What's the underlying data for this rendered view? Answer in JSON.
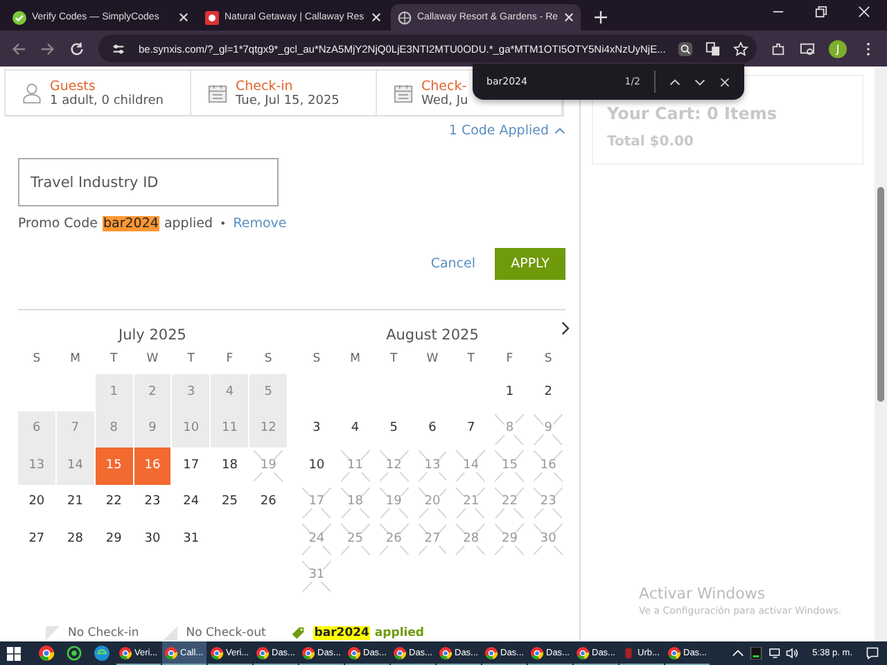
{
  "browser": {
    "tabs": [
      {
        "title": "Verify Codes — SimplyCodes",
        "kind": "check",
        "selected": false
      },
      {
        "title": "Natural Getaway | Callaway Res",
        "kind": "flower",
        "selected": false
      },
      {
        "title": "Callaway Resort & Gardens - Re",
        "kind": "globe",
        "selected": true
      }
    ],
    "url": "be.synxis.com/?_gl=1*7qtgx9*_gcl_au*NzA5MjY2NjQ0LjE3NTI2MTU0ODU.*_ga*MTM1OTI5OTY5Ni4xNzUyNjE...",
    "profile": "J",
    "find_bar": {
      "query": "bar2024",
      "count": "1/2"
    }
  },
  "summary": [
    {
      "kind": "guests",
      "label": "Guests",
      "value": "1 adult, 0 children"
    },
    {
      "kind": "date",
      "label": "Check-in",
      "value": "Tue, Jul 15, 2025"
    },
    {
      "kind": "date",
      "label": "Check-",
      "value": "Wed, Ju"
    }
  ],
  "codes_toggle": {
    "label": "1 Code Applied",
    "expanded": true
  },
  "travel_id": {
    "placeholder": "Travel Industry ID"
  },
  "promo": {
    "prefix": "Promo Code",
    "code": "bar2024",
    "suffix": "applied",
    "separator": "•",
    "remove": "Remove"
  },
  "actions": {
    "cancel": "Cancel",
    "apply": "APPLY"
  },
  "months": [
    {
      "title": "July 2025",
      "weekdays": [
        "S",
        "M",
        "T",
        "W",
        "T",
        "F",
        "S"
      ],
      "weeks": [
        [
          {
            "day": "1",
            "kind": "shaded"
          },
          {
            "day": "2",
            "kind": "shaded"
          },
          {
            "day": "3",
            "kind": "shaded"
          },
          {
            "day": "4",
            "kind": "shaded"
          },
          {
            "day": "5",
            "kind": "shaded"
          }
        ],
        [
          {
            "day": "6",
            "kind": "shaded"
          },
          {
            "day": "7",
            "kind": "shaded"
          },
          {
            "day": "8",
            "kind": "shaded"
          },
          {
            "day": "9",
            "kind": "shaded"
          },
          {
            "day": "10",
            "kind": "shaded"
          },
          {
            "day": "11",
            "kind": "shaded"
          },
          {
            "day": "12",
            "kind": "shaded"
          }
        ],
        [
          {
            "day": "13",
            "kind": "shaded"
          },
          {
            "day": "14",
            "kind": "shaded"
          },
          {
            "day": "15",
            "kind": "selected"
          },
          {
            "day": "16",
            "kind": "selected"
          },
          {
            "day": "17",
            "kind": "open"
          },
          {
            "day": "18",
            "kind": "open"
          },
          {
            "day": "19",
            "kind": "crossed"
          }
        ],
        [
          {
            "day": "20",
            "kind": "open"
          },
          {
            "day": "21",
            "kind": "open"
          },
          {
            "day": "22",
            "kind": "open"
          },
          {
            "day": "23",
            "kind": "open"
          },
          {
            "day": "24",
            "kind": "open"
          },
          {
            "day": "25",
            "kind": "open"
          },
          {
            "day": "26",
            "kind": "open"
          }
        ],
        [
          {
            "day": "27",
            "kind": "open"
          },
          {
            "day": "28",
            "kind": "open"
          },
          {
            "day": "29",
            "kind": "open"
          },
          {
            "day": "30",
            "kind": "open"
          },
          {
            "day": "31",
            "kind": "open"
          }
        ]
      ]
    },
    {
      "title": "August 2025",
      "weekdays": [
        "S",
        "M",
        "T",
        "W",
        "T",
        "F",
        "S"
      ],
      "weeks": [
        [
          {
            "day": "1",
            "kind": "open"
          },
          {
            "day": "2",
            "kind": "open"
          }
        ],
        [
          {
            "day": "3",
            "kind": "open"
          },
          {
            "day": "4",
            "kind": "open"
          },
          {
            "day": "5",
            "kind": "open"
          },
          {
            "day": "6",
            "kind": "open"
          },
          {
            "day": "7",
            "kind": "open"
          },
          {
            "day": "8",
            "kind": "crossed"
          },
          {
            "day": "9",
            "kind": "crossed"
          }
        ],
        [
          {
            "day": "10",
            "kind": "open"
          },
          {
            "day": "11",
            "kind": "crossed"
          },
          {
            "day": "12",
            "kind": "crossed"
          },
          {
            "day": "13",
            "kind": "crossed"
          },
          {
            "day": "14",
            "kind": "crossed"
          },
          {
            "day": "15",
            "kind": "crossed"
          },
          {
            "day": "16",
            "kind": "crossed"
          }
        ],
        [
          {
            "day": "17",
            "kind": "crossed"
          },
          {
            "day": "18",
            "kind": "crossed"
          },
          {
            "day": "19",
            "kind": "crossed"
          },
          {
            "day": "20",
            "kind": "crossed"
          },
          {
            "day": "21",
            "kind": "crossed"
          },
          {
            "day": "22",
            "kind": "crossed"
          },
          {
            "day": "23",
            "kind": "crossed"
          }
        ],
        [
          {
            "day": "24",
            "kind": "crossed"
          },
          {
            "day": "25",
            "kind": "crossed"
          },
          {
            "day": "26",
            "kind": "crossed"
          },
          {
            "day": "27",
            "kind": "crossed"
          },
          {
            "day": "28",
            "kind": "crossed"
          },
          {
            "day": "29",
            "kind": "crossed"
          },
          {
            "day": "30",
            "kind": "crossed"
          }
        ],
        [
          {
            "day": "31",
            "kind": "crossed"
          }
        ]
      ]
    }
  ],
  "legend": [
    {
      "kind": "no-checkin",
      "label": "No Check-in"
    },
    {
      "kind": "no-checkout",
      "label": "No Check-out"
    },
    {
      "kind": "promo",
      "code": "bar2024",
      "label": "applied"
    }
  ],
  "cart": {
    "title": "Your Cart: 0 Items",
    "total": "Total $0.00"
  },
  "watermark": {
    "title": "Activar Windows",
    "text": "Ve a Configuración para activar Windows."
  },
  "taskbar": {
    "pinned": [
      {
        "kind": "chrome"
      },
      {
        "kind": "whatsapp"
      },
      {
        "kind": "edge"
      }
    ],
    "apps": [
      {
        "label": "Veri...",
        "kind": "chrome",
        "selected": false
      },
      {
        "label": "Call...",
        "kind": "chrome",
        "selected": true
      },
      {
        "label": "Veri...",
        "kind": "chrome",
        "selected": false
      },
      {
        "label": "Das...",
        "kind": "chrome",
        "selected": false
      },
      {
        "label": "Das...",
        "kind": "chrome",
        "selected": false
      },
      {
        "label": "Das...",
        "kind": "chrome",
        "selected": false
      },
      {
        "label": "Das...",
        "kind": "chrome",
        "selected": false
      },
      {
        "label": "Das...",
        "kind": "chrome",
        "selected": false
      },
      {
        "label": "Das...",
        "kind": "chrome",
        "selected": false
      },
      {
        "label": "Das...",
        "kind": "chrome",
        "selected": false
      },
      {
        "label": "Das...",
        "kind": "chrome",
        "selected": false
      },
      {
        "label": "Urb...",
        "kind": "app",
        "selected": false
      },
      {
        "label": "Das...",
        "kind": "chrome",
        "selected": false
      }
    ],
    "time": "5:38 p. m."
  }
}
